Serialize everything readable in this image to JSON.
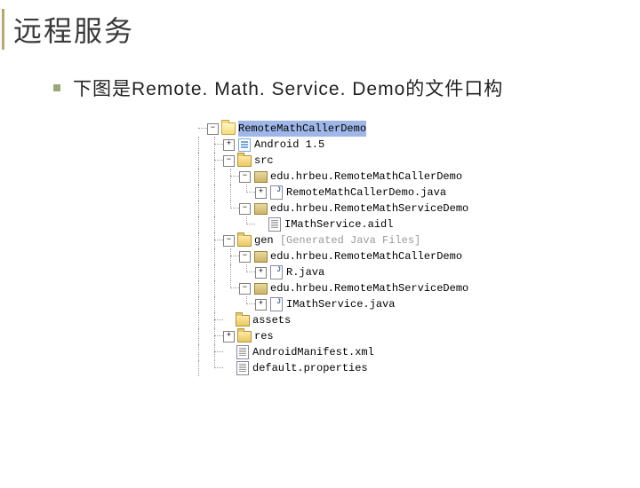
{
  "title": "远程服务",
  "bullet_text": "下图是Remote. Math. Service. Demo的文件口构",
  "tree": {
    "project": "RemoteMathCallerDemo",
    "android_lib": "Android 1.5",
    "src": "src",
    "pkg_caller": "edu.hrbeu.RemoteMathCallerDemo",
    "caller_java": "RemoteMathCallerDemo.java",
    "pkg_service": "edu.hrbeu.RemoteMathServiceDemo",
    "aidl": "IMathService.aidl",
    "gen": "gen",
    "gen_suffix": "[Generated Java Files]",
    "gen_pkg_caller": "edu.hrbeu.RemoteMathCallerDemo",
    "r_java": "R.java",
    "gen_pkg_service": "edu.hrbeu.RemoteMathServiceDemo",
    "imath_java": "IMathService.java",
    "assets": "assets",
    "res": "res",
    "manifest": "AndroidManifest.xml",
    "default_props": "default.properties"
  }
}
